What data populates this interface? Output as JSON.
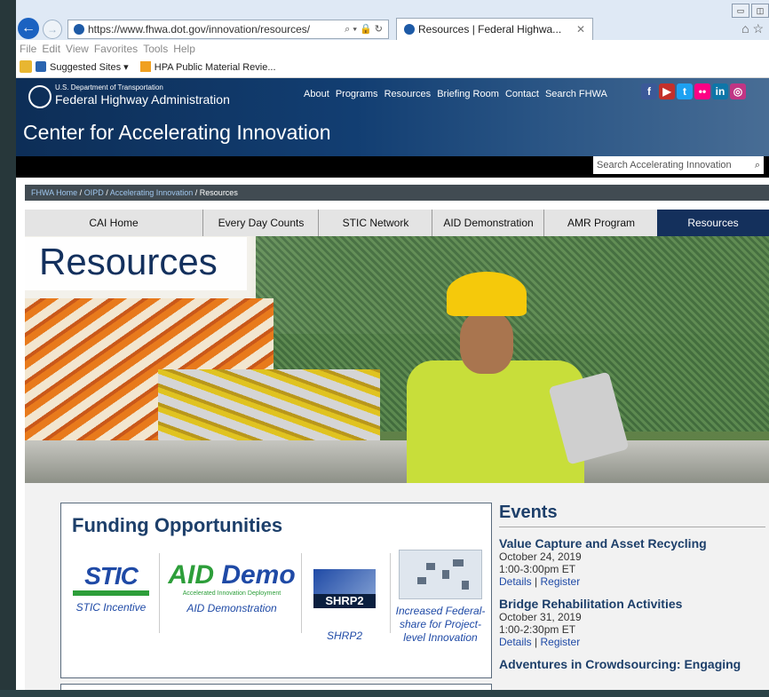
{
  "browser": {
    "url": "https://www.fhwa.dot.gov/innovation/resources/",
    "url_host_bold": "fhwa.dot.gov",
    "tab_title": "Resources | Federal Highwa...",
    "menu": [
      "File",
      "Edit",
      "View",
      "Favorites",
      "Tools",
      "Help"
    ],
    "favorites": [
      "Suggested Sites",
      "HPA Public Material Revie..."
    ]
  },
  "header": {
    "dept": "U.S. Department of Transportation",
    "agency": "Federal Highway Administration",
    "nav": [
      "About",
      "Programs",
      "Resources",
      "Briefing Room",
      "Contact",
      "Search FHWA"
    ],
    "social": [
      "f",
      "▶",
      "t",
      "••",
      "in",
      "◎"
    ],
    "social_colors": [
      "#3b5998",
      "#c4302b",
      "#1da1f2",
      "#ff0084",
      "#0e76a8",
      "#c13584"
    ],
    "site_title": "Center for Accelerating Innovation"
  },
  "search": {
    "placeholder": "Search Accelerating Innovation"
  },
  "breadcrumb": {
    "items": [
      "FHWA Home",
      "OIPD",
      "Accelerating Innovation"
    ],
    "current": "Resources"
  },
  "tabs": [
    "CAI Home",
    "Every Day Counts",
    "STIC Network",
    "AID Demonstration",
    "AMR Program",
    "Resources"
  ],
  "hero": {
    "title": "Resources"
  },
  "funding": {
    "heading": "Funding Opportunities",
    "items": [
      {
        "label": "STIC Incentive",
        "logo": "STIC"
      },
      {
        "label": "AID Demonstration",
        "logo_a": "AID",
        "logo_b": "Demo",
        "logo_sub": "Accelerated Innovation Deployment"
      },
      {
        "label": "SHRP2",
        "logo": "SHRP2"
      },
      {
        "label": "Increased Federal-share for Project-level Innovation"
      }
    ]
  },
  "events": {
    "heading": "Events",
    "items": [
      {
        "title": "Value Capture and Asset Recycling",
        "date": "October 24, 2019",
        "time": "1:00-3:00pm ET",
        "details": "Details",
        "register": "Register"
      },
      {
        "title": "Bridge Rehabilitation Activities",
        "date": "October 31, 2019",
        "time": "1:00-2:30pm ET",
        "details": "Details",
        "register": "Register"
      },
      {
        "title": "Adventures in Crowdsourcing: Engaging"
      }
    ]
  }
}
